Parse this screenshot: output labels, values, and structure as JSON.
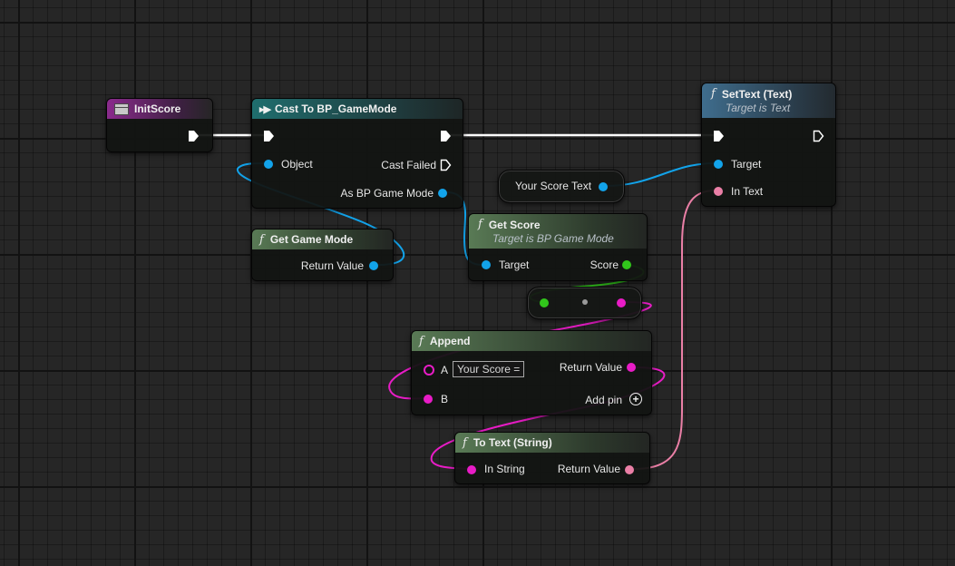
{
  "colors": {
    "exec": "#ffffff",
    "object_pin": "#12a3ea",
    "int_pin": "#31c61b",
    "string_pin": "#e81cc6",
    "text_pin": "#ea7fa6",
    "event_header": "#8a2b8c",
    "cast_header": "#1f6e6e",
    "function_header": "#597a55",
    "settext_header": "#3f6d8d"
  },
  "nodes": {
    "init_score": {
      "title": "InitScore",
      "icon": "event-grid-icon"
    },
    "cast": {
      "title": "Cast To BP_GameMode",
      "icon": "cast-icon",
      "object": "Object",
      "cast_failed": "Cast Failed",
      "as_gamemode": "As BP Game Mode"
    },
    "get_game_mode": {
      "title": "Get Game Mode",
      "return_value": "Return Value"
    },
    "set_text": {
      "title": "SetText (Text)",
      "subtitle": "Target is Text",
      "target": "Target",
      "in_text": "In Text"
    },
    "your_score_text": {
      "label": "Your Score Text"
    },
    "get_score": {
      "title": "Get Score",
      "subtitle": "Target is BP Game Mode",
      "target": "Target",
      "score": "Score"
    },
    "append": {
      "title": "Append",
      "a": "A",
      "a_value": "Your Score =",
      "b": "B",
      "return_value": "Return Value",
      "add_pin": "Add pin"
    },
    "to_text": {
      "title": "To Text (String)",
      "in_string": "In String",
      "return_value": "Return Value"
    }
  }
}
